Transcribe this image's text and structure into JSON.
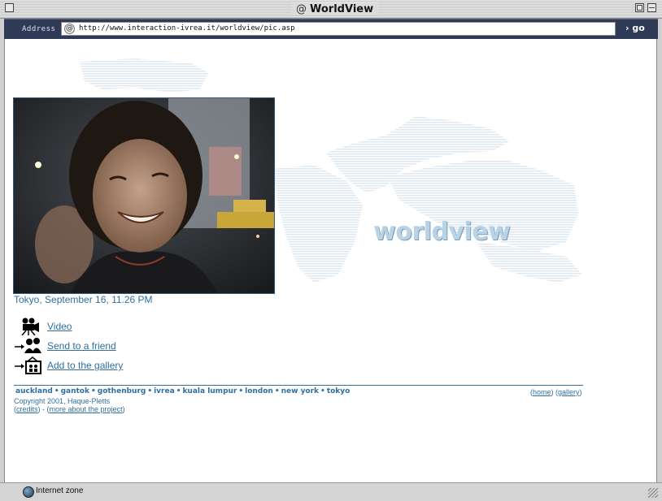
{
  "window": {
    "title": "WorldView",
    "title_glyph": "@"
  },
  "addressbar": {
    "label": "Address :",
    "url": "http://www.interaction-ivrea.it/worldview/pic.asp",
    "go_label": "go"
  },
  "page": {
    "logo_text": "worldview",
    "photo_caption": "Tokyo, September  16, 11.26 PM",
    "actions": [
      {
        "label": "Video",
        "icon": "video-camera-icon"
      },
      {
        "label": "Send to a friend",
        "icon": "send-friend-icon"
      },
      {
        "label": "Add to the gallery",
        "icon": "gallery-add-icon"
      }
    ],
    "cities": [
      "auckland",
      "gantok",
      "gothenburg",
      "ivrea",
      "kuala lumpur",
      "london",
      "new york",
      "tokyo"
    ],
    "right_links": {
      "home": "home",
      "gallery": "gallery"
    },
    "copyright": "Copyright 2001, Haque-Pletts",
    "credits_label": "credits",
    "more_label": "more about the project"
  },
  "status": {
    "zone": "Internet zone"
  },
  "colors": {
    "link": "#2f6fa0",
    "addressbar": "#2f3a57",
    "map": "#dde8f1"
  }
}
